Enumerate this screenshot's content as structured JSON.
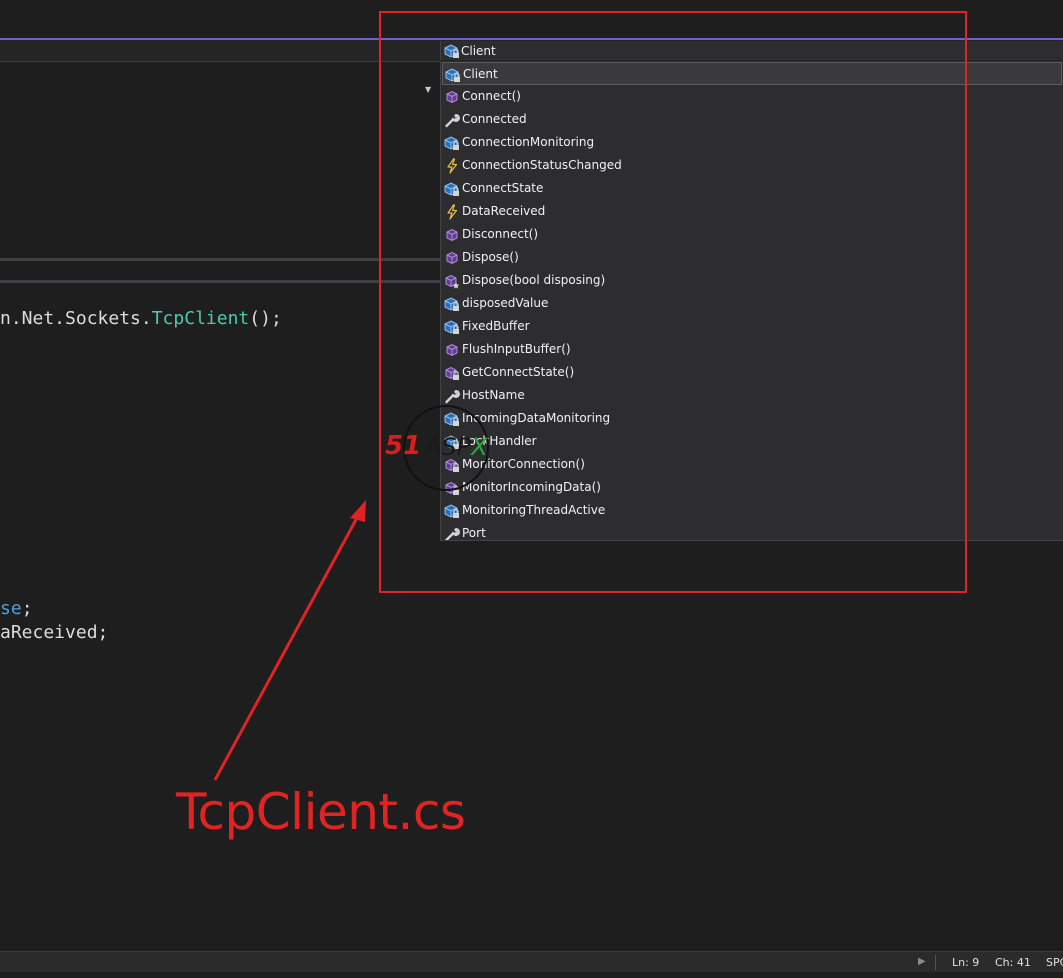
{
  "navbar": {
    "member_combo": {
      "selected": "Client",
      "icon": "field-locked-icon"
    }
  },
  "code": {
    "line1": {
      "prefix": "n.Net.Sockets.",
      "type": "TcpClient",
      "suffix": "();"
    },
    "line2": {
      "kw": "se",
      "suffix": ";"
    },
    "line3": {
      "text": "aReceived;"
    }
  },
  "dropdown": {
    "items": [
      {
        "label": "Client",
        "icon": "field-locked-icon",
        "selected": true
      },
      {
        "label": "Connect()",
        "icon": "method-icon"
      },
      {
        "label": "Connected",
        "icon": "property-wrench-icon"
      },
      {
        "label": "ConnectionMonitoring",
        "icon": "field-locked-icon"
      },
      {
        "label": "ConnectionStatusChanged",
        "icon": "event-lightning-icon"
      },
      {
        "label": "ConnectState",
        "icon": "field-locked-icon"
      },
      {
        "label": "DataReceived",
        "icon": "event-lightning-icon"
      },
      {
        "label": "Disconnect()",
        "icon": "method-icon"
      },
      {
        "label": "Dispose()",
        "icon": "method-icon"
      },
      {
        "label": "Dispose(bool disposing)",
        "icon": "method-protected-icon"
      },
      {
        "label": "disposedValue",
        "icon": "field-locked-icon"
      },
      {
        "label": "FixedBuffer",
        "icon": "field-locked-icon"
      },
      {
        "label": "FlushInputBuffer()",
        "icon": "method-icon"
      },
      {
        "label": "GetConnectState()",
        "icon": "method-locked-icon"
      },
      {
        "label": "HostName",
        "icon": "property-wrench-icon"
      },
      {
        "label": "IncomingDataMonitoring",
        "icon": "field-locked-icon"
      },
      {
        "label": "LockHandler",
        "icon": "field-locked-icon"
      },
      {
        "label": "MonitorConnection()",
        "icon": "method-locked-icon"
      },
      {
        "label": "MonitorIncomingData()",
        "icon": "method-locked-icon"
      },
      {
        "label": "MonitoringThreadActive",
        "icon": "field-locked-icon"
      },
      {
        "label": "Port",
        "icon": "property-wrench-icon"
      }
    ]
  },
  "annotation": {
    "label": "TcpClient.cs",
    "color": "#e02424"
  },
  "watermark": {
    "num": "51",
    "brand_main": "ASP",
    "brand_x": "X"
  },
  "status": {
    "ln": "Ln: 9",
    "ch": "Ch: 41",
    "spc": "SPC"
  },
  "colors": {
    "accent": "#6a63c9",
    "type": "#4ec9b0",
    "keyword": "#569cd6"
  }
}
